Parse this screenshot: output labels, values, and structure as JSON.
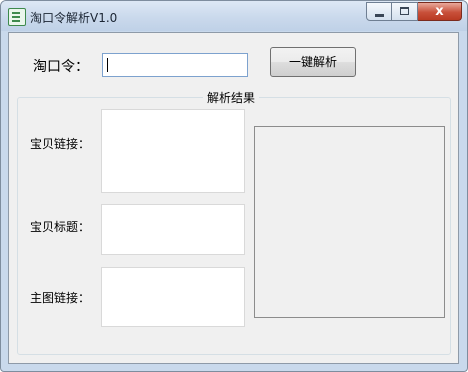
{
  "window": {
    "title": "淘口令解析V1.0",
    "close_glyph": "x"
  },
  "command": {
    "label": "淘口令：",
    "value": "",
    "button_label": "一键解析"
  },
  "result": {
    "group_title": "解析结果",
    "fields": [
      {
        "label": "宝贝链接：",
        "value": ""
      },
      {
        "label": "宝贝标题：",
        "value": ""
      },
      {
        "label": "主图链接：",
        "value": ""
      }
    ]
  }
}
